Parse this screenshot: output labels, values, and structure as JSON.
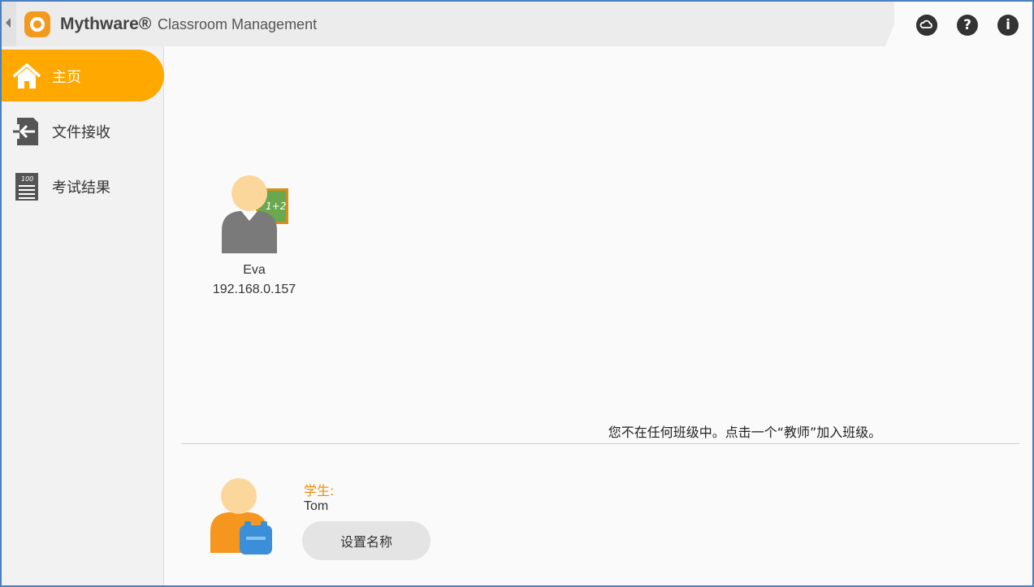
{
  "app": {
    "brand": "Mythware®",
    "subtitle": "Classroom Management"
  },
  "toolbar": {
    "icons": [
      "cloud-icon",
      "help-icon",
      "info-icon"
    ],
    "help_glyph": "?",
    "info_glyph": "i"
  },
  "sidebar": {
    "items": [
      {
        "label": "主页",
        "icon": "home-icon",
        "active": true
      },
      {
        "label": "文件接收",
        "icon": "file-receive-icon",
        "active": false
      },
      {
        "label": "考试结果",
        "icon": "exam-results-icon",
        "active": false
      }
    ]
  },
  "teacher": {
    "name": "Eva",
    "ip": "192.168.0.157",
    "board_text": "1+2"
  },
  "notice": "您不在任何班级中。点击一个“教师”加入班级。",
  "student": {
    "label": "学生:",
    "name": "Tom",
    "rename_button": "设置名称"
  },
  "colors": {
    "accent": "#ffa800",
    "student_label": "#f08a00",
    "border": "#4a7fc0"
  }
}
